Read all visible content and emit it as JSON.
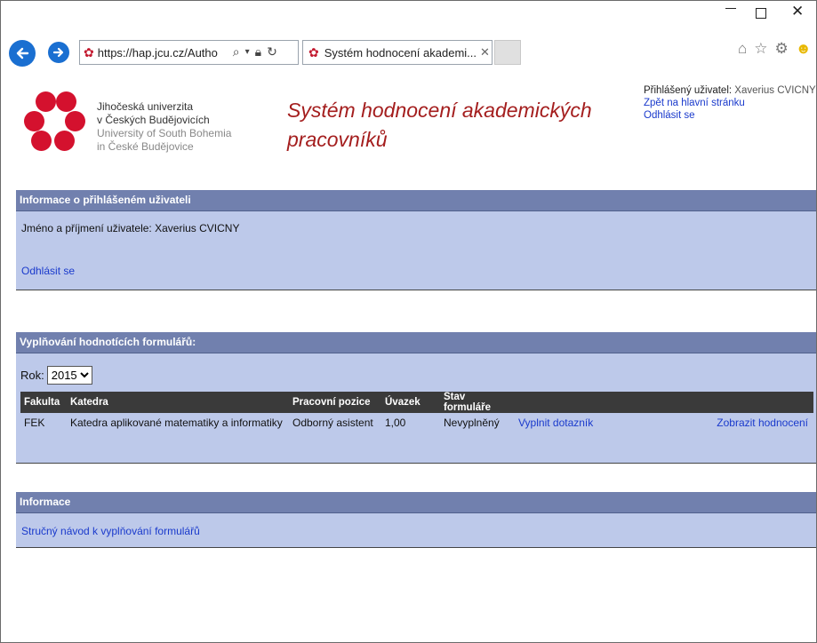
{
  "browser": {
    "address_url": "https://hap.jcu.cz/Autho",
    "tab_title": "Systém hodnocení akademi..."
  },
  "header": {
    "university_lines": [
      "Jihočeská univerzita",
      "v Českých Budějovicích"
    ],
    "university_lines_en": [
      "University of South Bohemia",
      "in České Budějovice"
    ],
    "app_title_line1": "Systém hodnocení akademických",
    "app_title_line2": "pracovníků",
    "user_label": "Přihlášený uživatel:",
    "user_name": "Xaverius CVICNY",
    "home_link": "Zpět na hlavní stránku",
    "logout_link": "Odhlásit se"
  },
  "panel_user": {
    "heading": "Informace o přihlášeném uživateli",
    "name_label": "Jméno a příjmení uživatele:",
    "name_value": "Xaverius CVICNY",
    "logout_link": "Odhlásit se"
  },
  "panel_forms": {
    "heading": "Vyplňování hodnotících formulářů:",
    "year_label": "Rok:",
    "year_value": "2015",
    "columns": [
      "Fakulta",
      "Katedra",
      "Pracovní pozice",
      "Úvazek",
      "Stav formuláře",
      "",
      ""
    ],
    "rows": [
      {
        "fakulta": "FEK",
        "katedra": "Katedra aplikované matematiky a informatiky",
        "pozice": "Odborný asistent",
        "uvazek": "1,00",
        "stav": "Nevyplněný",
        "fill_link": "Vyplnit dotazník",
        "view_link": "Zobrazit hodnocení"
      }
    ]
  },
  "panel_info": {
    "heading": "Informace",
    "guide_link": "Stručný návod k vyplňování formulářů"
  },
  "colors": {
    "panel_bg": "#bdc9ea",
    "panel_head": "#7180ae",
    "title_red": "#a41e1e",
    "link_blue": "#1a3acc",
    "logo_red": "#d4112e"
  }
}
